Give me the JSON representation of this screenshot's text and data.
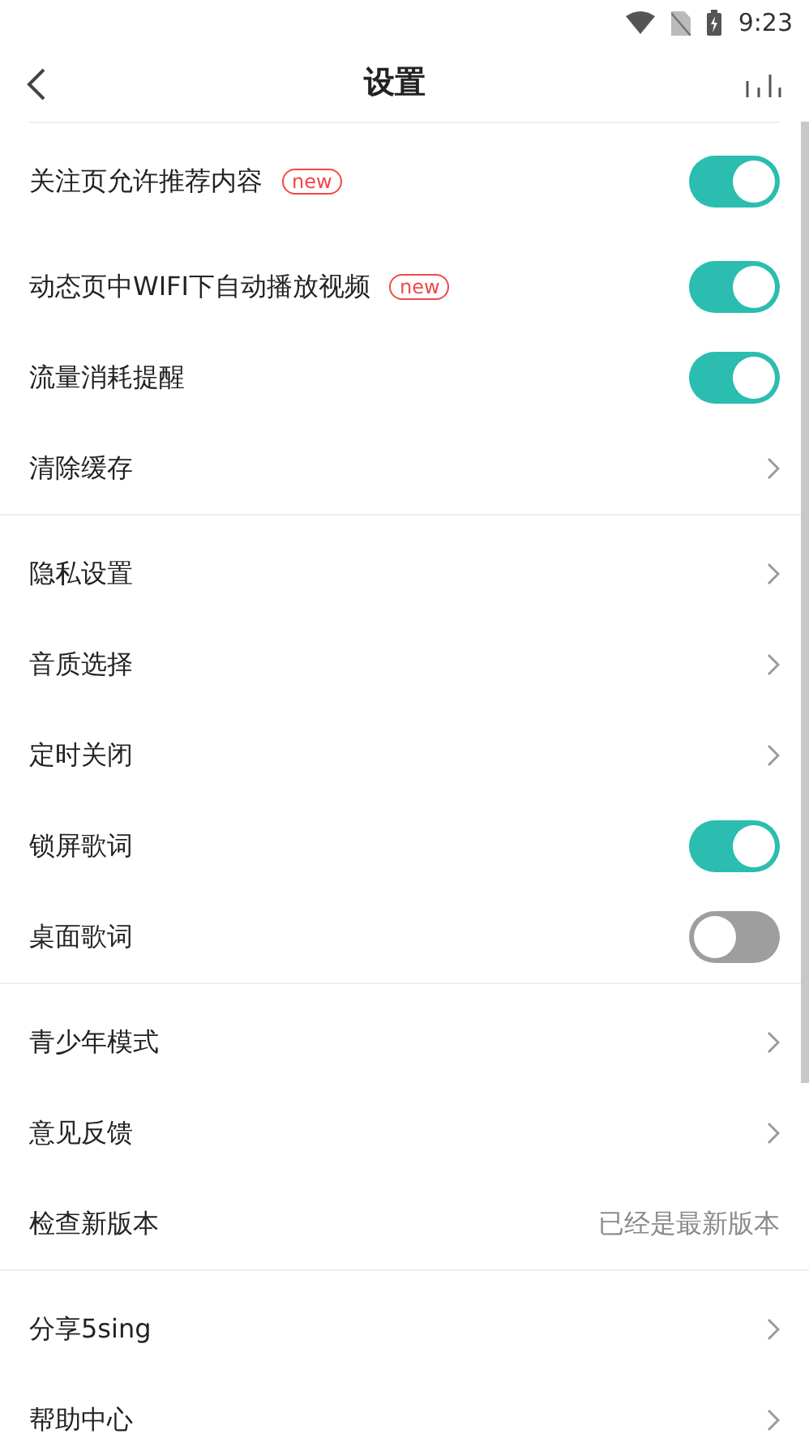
{
  "status_bar": {
    "time": "9:23"
  },
  "header": {
    "title": "设置"
  },
  "sections": [
    {
      "items": [
        {
          "kind": "toggle",
          "label": "关注页允许推荐内容",
          "badge": "new",
          "on": true
        },
        {
          "kind": "toggle",
          "label": "动态页中WIFI下自动播放视频",
          "badge": "new",
          "on": true
        },
        {
          "kind": "toggle",
          "label": "流量消耗提醒",
          "on": true
        },
        {
          "kind": "link",
          "label": "清除缓存"
        }
      ]
    },
    {
      "items": [
        {
          "kind": "link",
          "label": "隐私设置"
        },
        {
          "kind": "link",
          "label": "音质选择"
        },
        {
          "kind": "link",
          "label": "定时关闭"
        },
        {
          "kind": "toggle",
          "label": "锁屏歌词",
          "on": true
        },
        {
          "kind": "toggle",
          "label": "桌面歌词",
          "on": false
        }
      ]
    },
    {
      "items": [
        {
          "kind": "link",
          "label": "青少年模式"
        },
        {
          "kind": "link",
          "label": "意见反馈"
        },
        {
          "kind": "value",
          "label": "检查新版本",
          "value": "已经是最新版本"
        }
      ]
    },
    {
      "items": [
        {
          "kind": "link",
          "label": "分享5sing"
        },
        {
          "kind": "link",
          "label": "帮助中心"
        }
      ]
    }
  ]
}
